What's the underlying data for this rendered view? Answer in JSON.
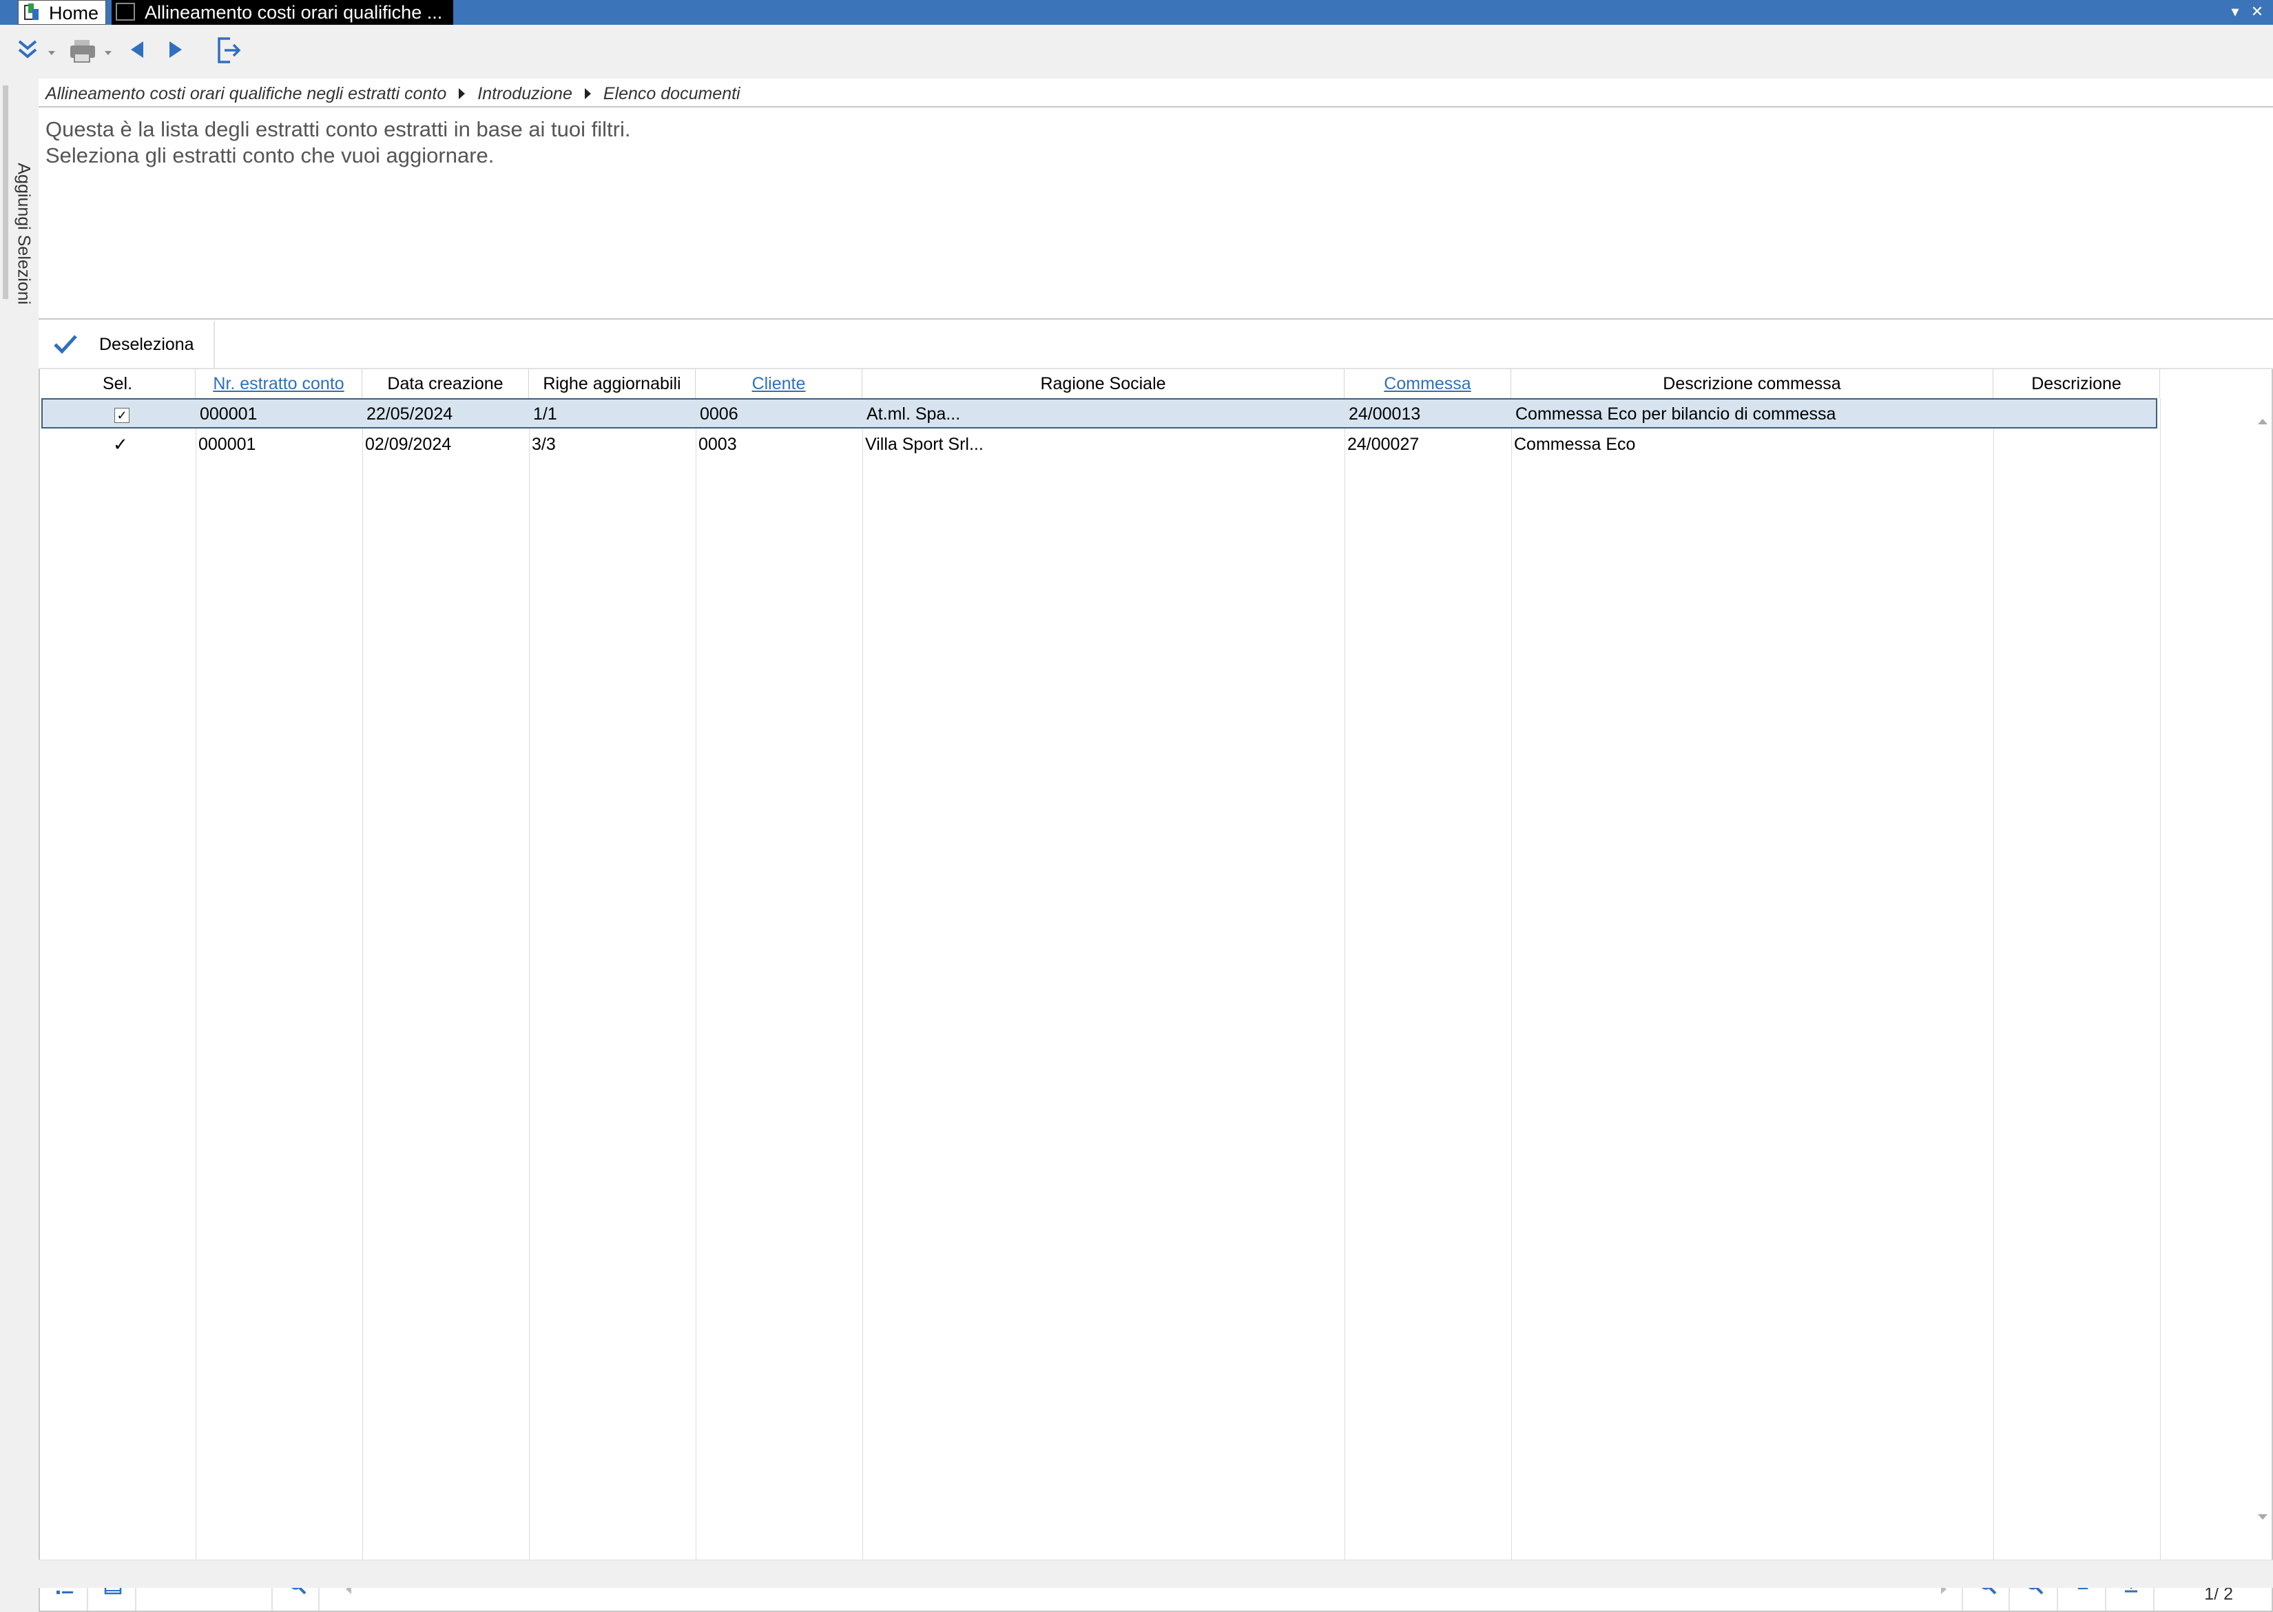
{
  "titlebar": {
    "home_tab": "Home",
    "active_tab": "Allineamento costi orari qualifiche ...",
    "minimize_icon": "chevron-down-icon",
    "close_icon": "close-icon"
  },
  "toolbar": {
    "icons": [
      "double-chevron-down-icon",
      "print-icon",
      "back-icon",
      "forward-icon",
      "exit-icon"
    ]
  },
  "sidetab": {
    "label": "Aggiungi Selezioni"
  },
  "breadcrumb": [
    "Allineamento costi orari qualifiche negli estratti conto",
    "Introduzione",
    "Elenco documenti"
  ],
  "intro": {
    "line1": "Questa è la lista degli estratti conto estratti in base ai tuoi filtri.",
    "line2": "Seleziona gli estratti conto che vuoi aggiornare."
  },
  "actions": {
    "deselect_label": "Deseleziona"
  },
  "table": {
    "columns": [
      "Sel.",
      "Nr. estratto conto",
      "Data creazione",
      "Righe aggiornabili",
      "Cliente",
      "Ragione Sociale",
      "Commessa",
      "Descrizione commessa",
      "Descrizione"
    ],
    "rows": [
      {
        "sel": "✓",
        "nr": "000001",
        "data": "22/05/2024",
        "righe": "1/1",
        "cliente": "0006",
        "ragione": "At.ml. Spa...",
        "commessa": "24/00013",
        "desc_commessa": "Commessa Eco per bilancio di commessa",
        "descrizione": ""
      },
      {
        "sel": "✓",
        "nr": "000001",
        "data": "02/09/2024",
        "righe": "3/3",
        "cliente": "0003",
        "ragione": "Villa Sport Srl...",
        "commessa": "24/00027",
        "desc_commessa": "Commessa Eco",
        "descrizione": ""
      }
    ]
  },
  "pager": {
    "text": "1/  2"
  },
  "colors": {
    "titlebar": "#3c74b9",
    "accent": "#2f6fbf",
    "selected_row": "#d7e4ef"
  }
}
